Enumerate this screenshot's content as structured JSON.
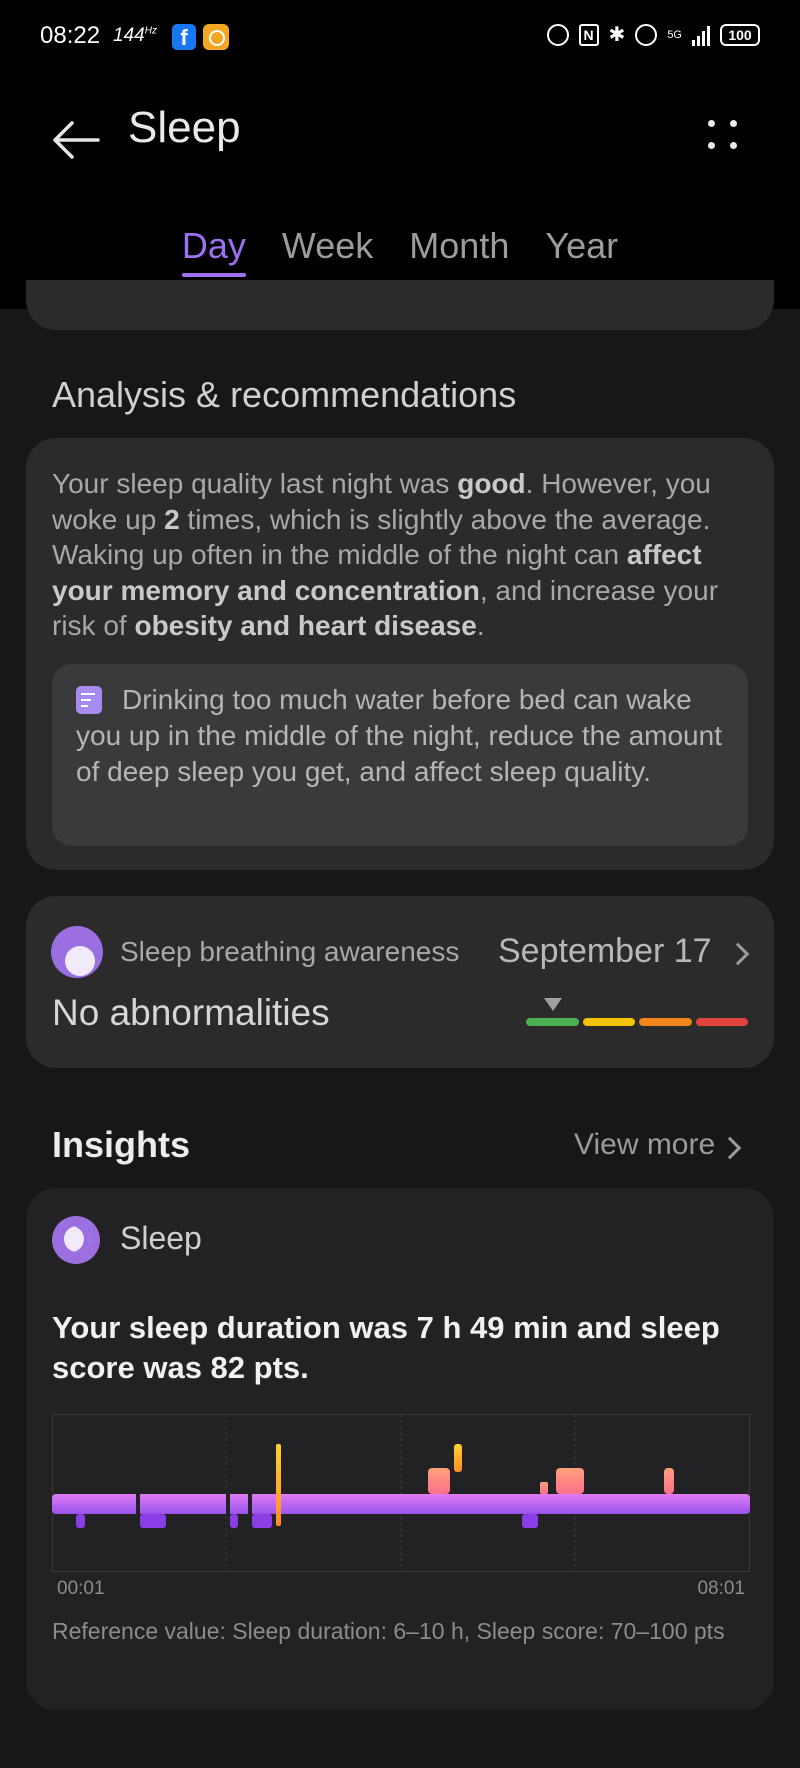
{
  "status_bar": {
    "time": "08:22",
    "refresh_rate": "144",
    "refresh_unit": "Hz",
    "battery": "100",
    "network": "5G"
  },
  "header": {
    "title": "Sleep",
    "tabs": [
      {
        "label": "Day",
        "active": true
      },
      {
        "label": "Week",
        "active": false
      },
      {
        "label": "Month",
        "active": false
      },
      {
        "label": "Year",
        "active": false
      }
    ]
  },
  "analysis": {
    "title": "Analysis & recommendations",
    "paragraph": [
      {
        "text": "Your sleep quality last night was ",
        "bold": false
      },
      {
        "text": "good",
        "bold": true
      },
      {
        "text": ". However, you woke up ",
        "bold": false
      },
      {
        "text": "2",
        "bold": true
      },
      {
        "text": " times, which is slightly above the average. Waking up often in the middle of the night can ",
        "bold": false
      },
      {
        "text": "affect your memory and concentration",
        "bold": true
      },
      {
        "text": ", and increase your risk of ",
        "bold": false
      },
      {
        "text": "obesity and heart disease",
        "bold": true
      },
      {
        "text": ".",
        "bold": false
      }
    ],
    "tip": "Drinking too much water before bed can wake you up in the middle of the night, reduce the amount of deep sleep you get, and affect sleep quality."
  },
  "breathing": {
    "label": "Sleep breathing awareness",
    "date": "September 17",
    "status": "No abnormalities",
    "scale_colors": [
      "#4caf50",
      "#f5c400",
      "#f0841a",
      "#e0443c"
    ],
    "level_fraction": 0.12
  },
  "insights": {
    "title": "Insights",
    "view_more": "View more",
    "card_label": "Sleep",
    "headline": "Your sleep duration was 7 h 49 min and sleep score was 82 pts.",
    "chart": {
      "start_label": "00:01",
      "end_label": "08:01"
    },
    "reference": "Reference value: Sleep duration: 6–10 h, Sleep score: 70–100 pts"
  },
  "colors": {
    "accent": "#a070f2",
    "light_sleep": "#b873f0",
    "deep_sleep": "#8a3ee6",
    "rem": "#ff8f73",
    "awake": "#f5a623"
  }
}
